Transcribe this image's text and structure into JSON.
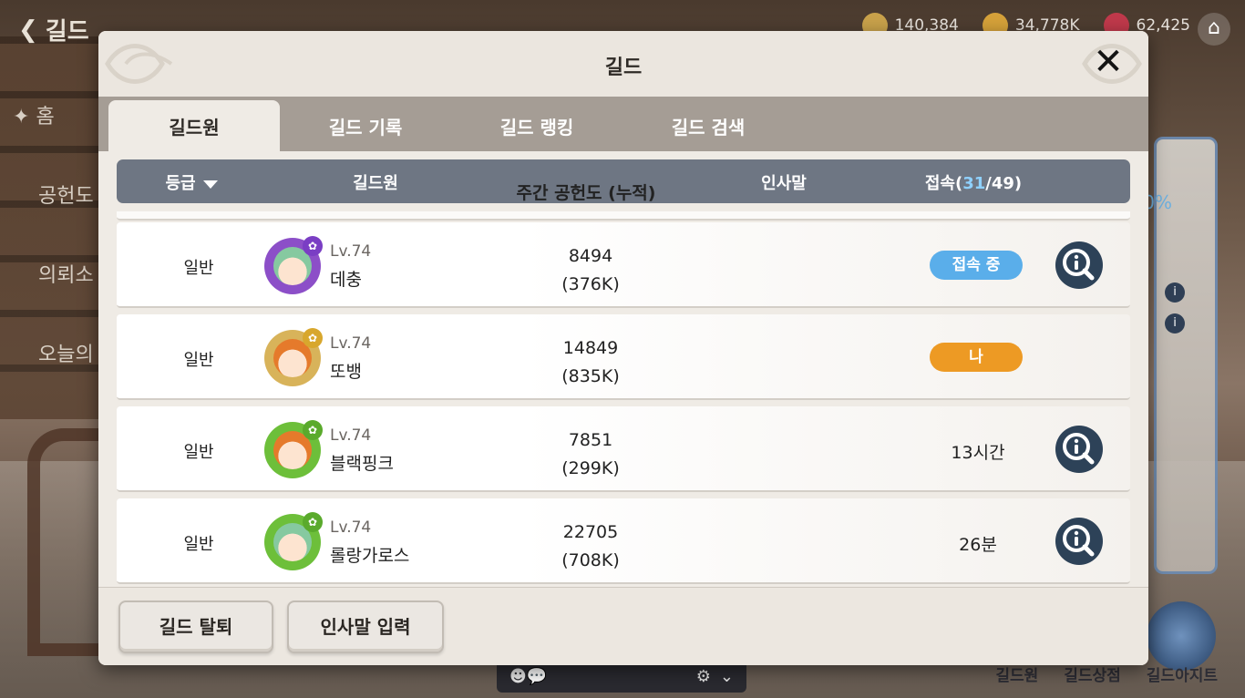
{
  "background": {
    "nav_title": "길드",
    "resources": [
      {
        "icon": "globe-coin-icon",
        "value": "140,384",
        "color": "#c9a24b"
      },
      {
        "icon": "gold-coin-icon",
        "value": "34,778K",
        "color": "#d6a23a"
      },
      {
        "icon": "red-gem-icon",
        "value": "62,425",
        "color": "#c0394b"
      }
    ],
    "left_menu": [
      "홈",
      "공헌도",
      "의뢰소",
      "오늘의"
    ],
    "side_percent": "0%",
    "dock": [
      "길드원",
      "길드상점",
      "길드아지트"
    ]
  },
  "modal": {
    "title": "길드",
    "close_label": "✕"
  },
  "tabs": [
    {
      "label": "길드원",
      "active": true
    },
    {
      "label": "길드 기록",
      "active": false
    },
    {
      "label": "길드 랭킹",
      "active": false
    },
    {
      "label": "길드 검색",
      "active": false
    }
  ],
  "table": {
    "headers": {
      "rank": "등급",
      "member": "길드원",
      "contribution": "주간 공헌도 (누적)",
      "greeting": "인사말",
      "connection_label": "접속(",
      "connection_online": "31",
      "connection_total": "/49)"
    },
    "rows": [
      {
        "rank": "일반",
        "level": "Lv.74",
        "name": "데충",
        "weekly": "8494",
        "total": "(376K)",
        "status": "접속 중",
        "status_type": "online",
        "avatar_ring": "#8c4fc8",
        "avatar_hair": "#86c9a0",
        "badge_color": "#7a3ec4",
        "inspect": true
      },
      {
        "rank": "일반",
        "level": "Lv.74",
        "name": "또뱅",
        "weekly": "14849",
        "total": "(835K)",
        "status": "나",
        "status_type": "me",
        "avatar_ring": "#d8b35a",
        "avatar_hair": "#e57a2b",
        "badge_color": "#d8a72d",
        "inspect": false
      },
      {
        "rank": "일반",
        "level": "Lv.74",
        "name": "블랙핑크",
        "weekly": "7851",
        "total": "(299K)",
        "status": "13시간",
        "status_type": "text",
        "avatar_ring": "#6dbf3a",
        "avatar_hair": "#e57a2b",
        "badge_color": "#5aaa2c",
        "inspect": true
      },
      {
        "rank": "일반",
        "level": "Lv.74",
        "name": "롤랑가로스",
        "weekly": "22705",
        "total": "(708K)",
        "status": "26분",
        "status_type": "text",
        "avatar_ring": "#6dbf3a",
        "avatar_hair": "#86c9a0",
        "badge_color": "#5aaa2c",
        "inspect": true
      }
    ]
  },
  "footer": {
    "leave_label": "길드 탈퇴",
    "greeting_label": "인사말 입력"
  },
  "colors": {
    "online_pill": "#5aaeea",
    "me_pill": "#ed9a24",
    "header_bar": "#6e7683",
    "tab_bar": "#a59d95",
    "inspect_button": "#2d4258"
  }
}
